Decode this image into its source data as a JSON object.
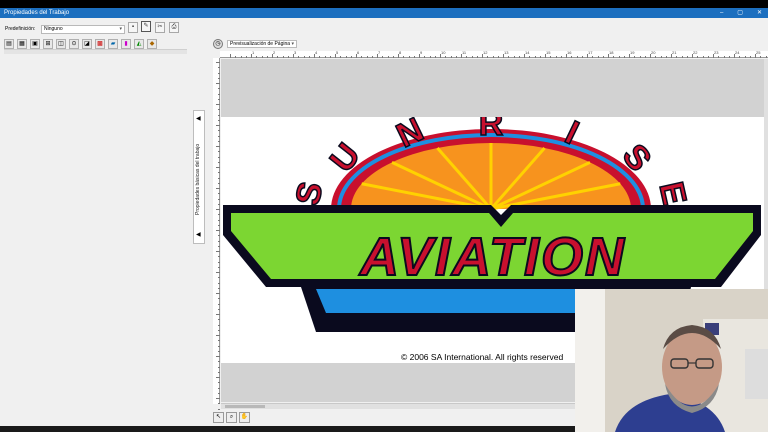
{
  "window": {
    "title": "Propiedades del Trabajo",
    "controls": [
      "–",
      "▢",
      "✕"
    ]
  },
  "toolbar": {
    "preset_label": "Predefinición:",
    "preset_value": "Ninguno"
  },
  "side_panel": {
    "title": "Propiedades básicas del trabajo"
  },
  "preview": {
    "mode_value": "Previsualización de Página",
    "ruler_labels": [
      "1",
      "2",
      "3",
      "4",
      "5",
      "6",
      "7",
      "8",
      "9",
      "10",
      "11",
      "12",
      "13",
      "14",
      "15",
      "16",
      "17",
      "18",
      "19",
      "20",
      "21",
      "22",
      "23",
      "24",
      "25"
    ]
  },
  "artwork": {
    "top_letters": [
      "S",
      "U",
      "N",
      "R",
      "I",
      "S",
      "E"
    ],
    "main_word": "AVIATION",
    "copyright": "© 2006 SA International. All rights reserved",
    "colors": {
      "red": "#c8102e",
      "orange": "#f7931e",
      "yellow": "#ffd200",
      "green": "#7cd632",
      "blue": "#1e8fe0",
      "dark": "#0a0a1e"
    }
  },
  "colors": {
    "titlebar": "#1c6fbf",
    "panel_bg": "#f0f0f0"
  }
}
